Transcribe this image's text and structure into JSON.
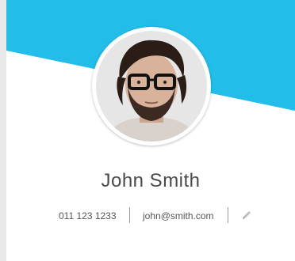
{
  "profile": {
    "name": "John Smith",
    "phone": "011 123 1233",
    "email": "john@smith.com"
  },
  "colors": {
    "accent": "#22bde8",
    "card_background": "#ffffff",
    "page_background": "#e9e9e9"
  },
  "icons": {
    "edit": "pencil-icon"
  }
}
